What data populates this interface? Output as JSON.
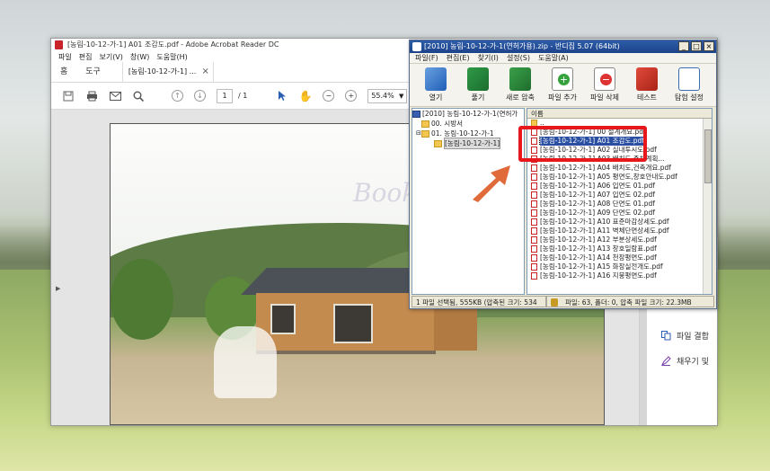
{
  "acrobat": {
    "title": "[농림-10-12-가-1] A01 조감도.pdf - Adobe Acrobat Reader DC",
    "menu": [
      "파일",
      "편집",
      "보기(V)",
      "창(W)",
      "도움말(H)"
    ],
    "tabs": {
      "home": "홈",
      "tools": "도구",
      "document": "[농림-10-12-가-1] ..."
    },
    "toolbar": {
      "current_page": "1",
      "total_pages": "/ 1",
      "zoom": "55.4%"
    },
    "right_panel": [
      "파일 결합",
      "채우기 및"
    ]
  },
  "bandizip": {
    "title": "[2010] 농림-10-12-가-1(연허가용).zip - 반디집 5.07 (64bit)",
    "menu": [
      "파일(F)",
      "편집(E)",
      "찾기(I)",
      "설정(S)",
      "도움말(A)"
    ],
    "toolbar": [
      "열기",
      "풀기",
      "새로 압축",
      "파일 추가",
      "파일 삭제",
      "테스트",
      "탐험 설정"
    ],
    "tree": [
      "[2010] 농림-10-12-가-1(연허가",
      "00. 시방서",
      "01. 농림-10-12-가-1",
      "[농림-10-12-가-1]"
    ],
    "list_header": "이름",
    "files": [
      "..",
      "[농림-10-12-가-1] 00 설계개요.pdf",
      "[농림-10-12-가-1] A01 조감도.pdf",
      "[농림-10-12-가-1] A02 실내투시도.pdf",
      "[농림-10-12-가-1] A03 배치도,주차계획...",
      "[농림-10-12-가-1] A04 배치도,건축개요.pdf",
      "[농림-10-12-가-1] A05 평면도,창호안내도.pdf",
      "[농림-10-12-가-1] A06 입면도 01.pdf",
      "[농림-10-12-가-1] A07 입면도 02.pdf",
      "[농림-10-12-가-1] A08 단면도 01.pdf",
      "[농림-10-12-가-1] A09 단면도 02.pdf",
      "[농림-10-12-가-1] A10 표준마감상세도.pdf",
      "[농림-10-12-가-1] A11 벽체단면상세도.pdf",
      "[농림-10-12-가-1] A12 부분상세도.pdf",
      "[농림-10-12-가-1] A13 창호일람표.pdf",
      "[농림-10-12-가-1] A14 천장평면도.pdf",
      "[농림-10-12-가-1] A15 화장실전개도.pdf",
      "[농림-10-12-가-1] A16 지붕평면도.pdf"
    ],
    "status_left": "1 파일 선택됨, 555KB (압축된 크기: 534",
    "status_right": "파일: 63, 폴더: 0, 압축 파일 크기: 22.3MB"
  },
  "colors": {
    "highlight": "#e8171c",
    "arrow": "#e06a3a",
    "bandizip_title": "#2d5ca8"
  }
}
